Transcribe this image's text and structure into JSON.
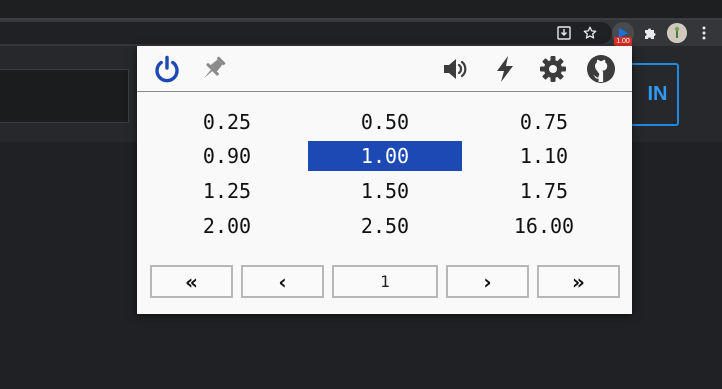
{
  "browser": {
    "extension_badge": "1.00",
    "toolbar_icons": [
      "install-icon",
      "star-icon",
      "speed-extension-icon",
      "puzzle-icon",
      "avatar",
      "kebab-menu-icon"
    ]
  },
  "page": {
    "button_text": "IN"
  },
  "popup": {
    "header_icons": [
      "power-icon",
      "pin-icon",
      "volume-icon",
      "bolt-icon",
      "gear-icon",
      "github-icon"
    ],
    "accent_color": "#1d49b4",
    "speeds": [
      "0.25",
      "0.50",
      "0.75",
      "0.90",
      "1.00",
      "1.10",
      "1.25",
      "1.50",
      "1.75",
      "2.00",
      "2.50",
      "16.00"
    ],
    "selected_speed": "1.00",
    "pagination": {
      "first_icon": "double-chevron-left-icon",
      "prev_icon": "chevron-left-icon",
      "current_page": "1",
      "next_icon": "chevron-right-icon",
      "last_icon": "double-chevron-right-icon"
    }
  }
}
